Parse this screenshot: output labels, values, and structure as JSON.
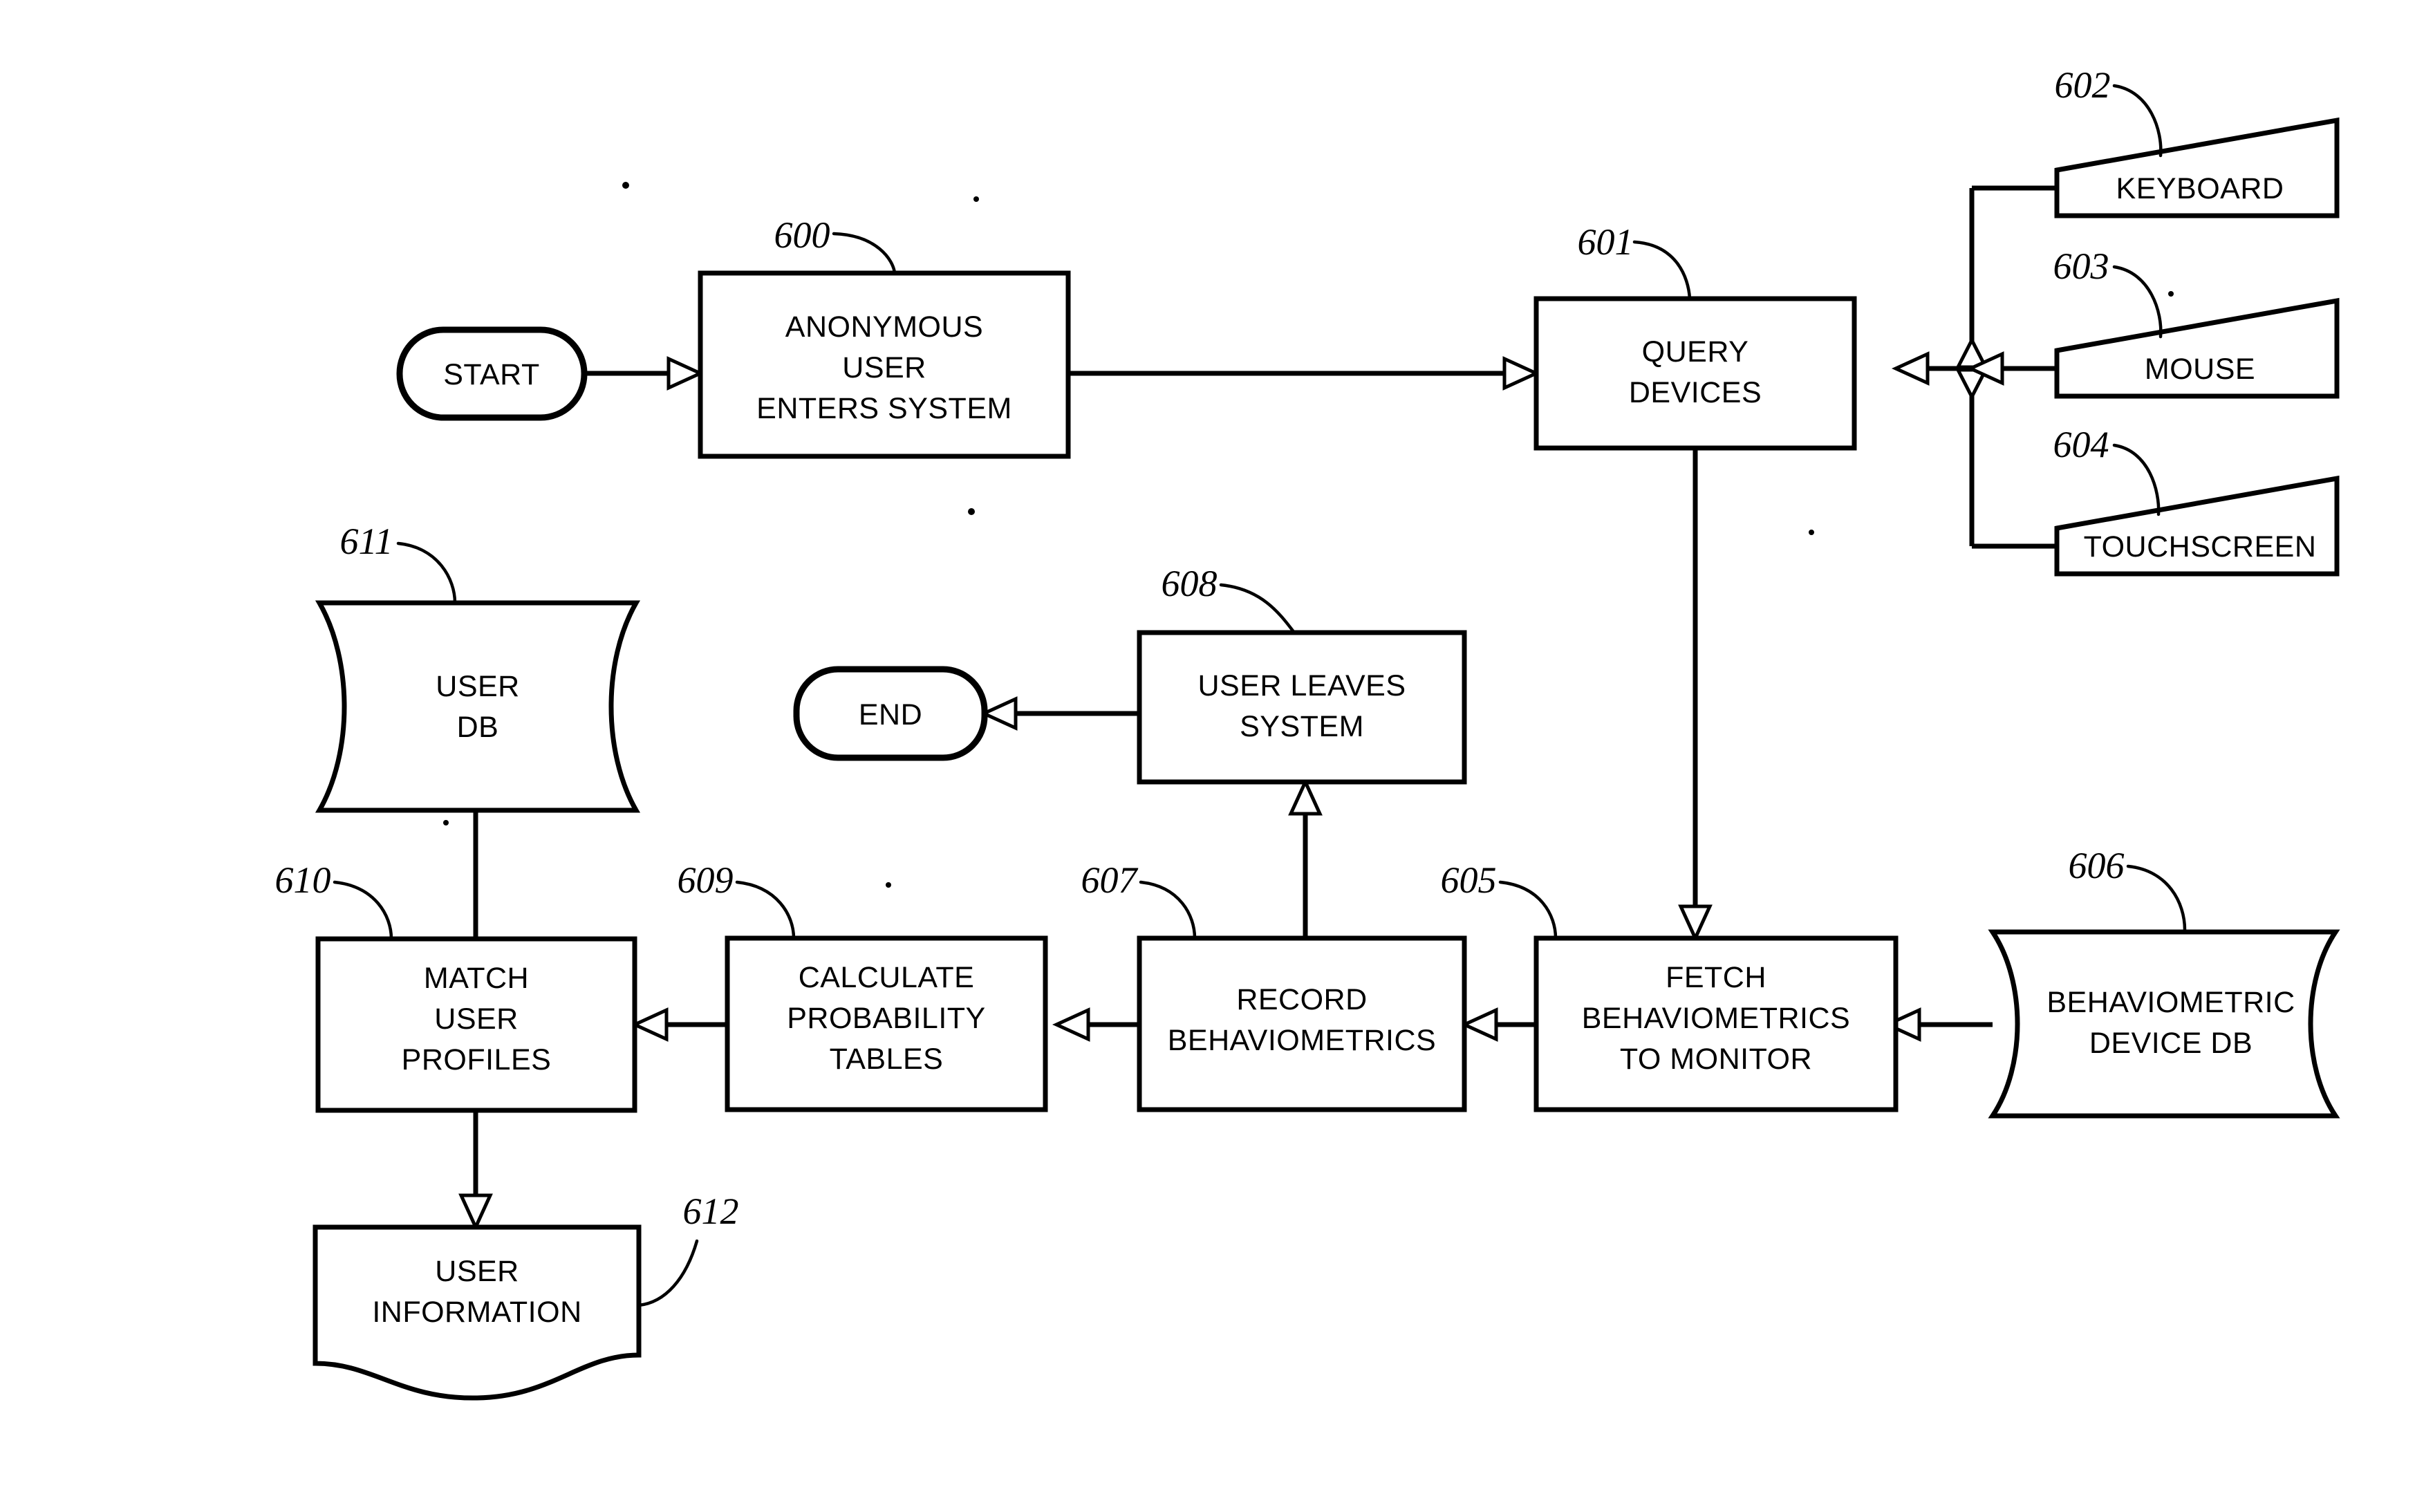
{
  "figure": {
    "kind": "patent-flowchart",
    "background_color": "#ffffff",
    "line_color": "#000000"
  },
  "terminators": [
    {
      "id": "start",
      "label": "START"
    },
    {
      "id": "end",
      "label": "END"
    }
  ],
  "nodes": [
    {
      "id": "n600",
      "ref": "600",
      "shape": "process",
      "lines": [
        "ANONYMOUS",
        "USER",
        "ENTERS  SYSTEM"
      ]
    },
    {
      "id": "n601",
      "ref": "601",
      "shape": "process",
      "lines": [
        "QUERY",
        "DEVICES"
      ]
    },
    {
      "id": "n602",
      "ref": "602",
      "shape": "device",
      "lines": [
        "KEYBOARD"
      ]
    },
    {
      "id": "n603",
      "ref": "603",
      "shape": "device",
      "lines": [
        "MOUSE"
      ]
    },
    {
      "id": "n604",
      "ref": "604",
      "shape": "device",
      "lines": [
        "TOUCHSCREEN"
      ]
    },
    {
      "id": "n605",
      "ref": "605",
      "shape": "process",
      "lines": [
        "FETCH",
        "BEHAVIOMETRICS",
        "TO  MONITOR"
      ]
    },
    {
      "id": "n606",
      "ref": "606",
      "shape": "database",
      "lines": [
        "BEHAVIOMETRIC",
        "DEVICE  DB"
      ]
    },
    {
      "id": "n607",
      "ref": "607",
      "shape": "process",
      "lines": [
        "RECORD",
        "BEHAVIOMETRICS"
      ]
    },
    {
      "id": "n608",
      "ref": "608",
      "shape": "process",
      "lines": [
        "USER  LEAVES",
        "SYSTEM"
      ]
    },
    {
      "id": "n609",
      "ref": "609",
      "shape": "process",
      "lines": [
        "CALCULATE",
        "PROBABILITY",
        "TABLES"
      ]
    },
    {
      "id": "n610",
      "ref": "610",
      "shape": "process",
      "lines": [
        "MATCH",
        "USER",
        "PROFILES"
      ]
    },
    {
      "id": "n611",
      "ref": "611",
      "shape": "database",
      "lines": [
        "USER",
        "DB"
      ]
    },
    {
      "id": "n612",
      "ref": "612",
      "shape": "document",
      "lines": [
        "USER",
        "INFORMATION"
      ]
    }
  ],
  "reference_numerals": [
    "600",
    "601",
    "602",
    "603",
    "604",
    "605",
    "606",
    "607",
    "608",
    "609",
    "610",
    "611",
    "612"
  ],
  "edges": [
    {
      "from": "start",
      "to": "n600",
      "arrow": "open"
    },
    {
      "from": "n600",
      "to": "n601",
      "arrow": "open"
    },
    {
      "from": "n602",
      "to": "n601",
      "arrow": "open"
    },
    {
      "from": "n603",
      "to": "n601",
      "arrow": "open"
    },
    {
      "from": "n604",
      "to": "n601",
      "arrow": "open"
    },
    {
      "from": "n601",
      "to": "n605",
      "arrow": "open"
    },
    {
      "from": "n606",
      "to": "n605",
      "arrow": "open"
    },
    {
      "from": "n605",
      "to": "n607",
      "arrow": "open"
    },
    {
      "from": "n607",
      "to": "n609",
      "arrow": "open"
    },
    {
      "from": "n607",
      "to": "n608",
      "arrow": "open"
    },
    {
      "from": "n609",
      "to": "n610",
      "arrow": "open"
    },
    {
      "from": "n611",
      "to": "n610",
      "arrow": "none"
    },
    {
      "from": "n610",
      "to": "n612",
      "arrow": "open"
    },
    {
      "from": "n608",
      "to": "end",
      "arrow": "open"
    }
  ]
}
